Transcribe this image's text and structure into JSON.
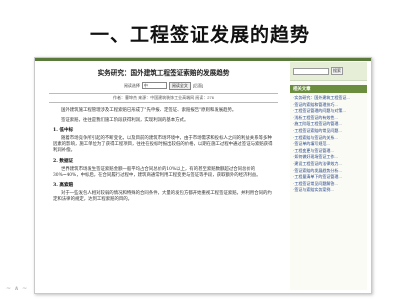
{
  "slide": {
    "title": "一、工程签证发展的趋势",
    "watermark": "~ ∧ ~"
  },
  "article": {
    "title": "实务研究：国外建筑工程签证索赔的发展趋势",
    "search": {
      "label": "阅读选择",
      "value": "中",
      "button": "阅读全文",
      "suffix": "[后面]"
    },
    "meta": "作者：曹坤杰 来源：中国建筑装饰工业高端网 阅读：276",
    "paragraphs": [
      "国外建筑施工程管理涉及工程索赔已形成了\"先申报、定签证、索赔报告\"原则和发展趋势。",
      "签证索赔，往往是我们施工阶段获得利润，实现利润的基本方式。"
    ],
    "sections": [
      {
        "heading": "1. 低中标",
        "text": "随着市场竞争所引起的不断变化，以及目前的建筑市场环境中，由于市场需求和投标人之间的利益关系等多种因素的影响，施工单位为了获得工程项目，往往在投标时报出较低的价格，以期在施工过程中通过签证与索赔获得利润补偿。"
      },
      {
        "heading": "2. 数据证",
        "text": "世界建筑市场发生签证索赔金额一般平均占合同总价的10%以上，有的甚至索赔数额超过合同总价的30%~40%，中标后，在合同履行过程中，建筑商通常利用工程变更与签证等手段，获取额外的经济利益。"
      },
      {
        "heading": "3. 高索赔",
        "text": "对于一些发包人相对较弱的情况和特殊的合同条件，大量的发包方都开始重视工程签证索赔，并利用合同的约定和法律的规定，达到工程索赔的目的。"
      }
    ]
  },
  "sidebar": {
    "go_label": "搜索",
    "header": "相关文章",
    "items": [
      "实务研究：国外建筑工程签证...",
      "签证的索赔和管理技巧...",
      "工程签证管理的问题与对策...",
      "浅析工程签证的有效性...",
      "施工阶段工程签证的管理...",
      "工程签证索赔的常见问题...",
      "工程索赔与签证的关系...",
      "签证单的填写规范...",
      "工程变更与签证管理...",
      "如何做好现场签证工作...",
      "建设工程签证的法律效力...",
      "签证索赔的发展趋势分析...",
      "工程量清单下的签证管理...",
      "工程签证常见问题解答...",
      "签证与索赔实务案例..."
    ]
  },
  "colors": {
    "accent": "#6a8e3e",
    "link": "#1b3f8a",
    "topbar": "#5a7a3c"
  }
}
